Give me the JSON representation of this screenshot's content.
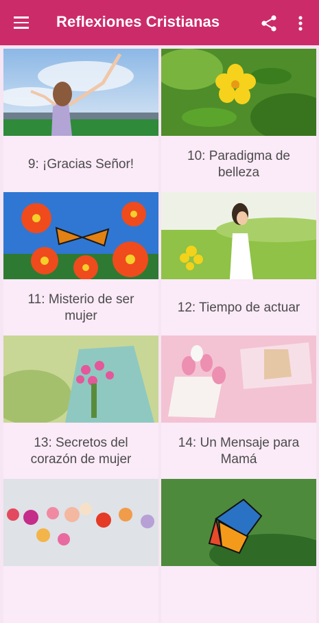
{
  "app_bar": {
    "title": "Reflexiones Cristianas",
    "menu_icon": "hamburger-menu-icon",
    "share_icon": "share-icon",
    "more_icon": "more-vert-icon",
    "color": "#cc2b6a"
  },
  "cards": [
    {
      "label": "9: ¡Gracias Señor!",
      "image": "woman-arms-raised-sky"
    },
    {
      "label": "10: Paradigma de belleza",
      "image": "yellow-flower-leaves"
    },
    {
      "label": "11: Misterio de ser mujer",
      "image": "orange-flowers-butterfly"
    },
    {
      "label": "12: Tiempo de actuar",
      "image": "woman-yellow-flowers-field"
    },
    {
      "label": "13: Secretos del corazón de mujer",
      "image": "woman-holding-bouquet"
    },
    {
      "label": "14: Un Mensaje para Mamá",
      "image": "pink-tulips-gift"
    },
    {
      "label": "",
      "image": "colorful-paper-flowers"
    },
    {
      "label": "",
      "image": "butterfly-on-leaf"
    }
  ]
}
